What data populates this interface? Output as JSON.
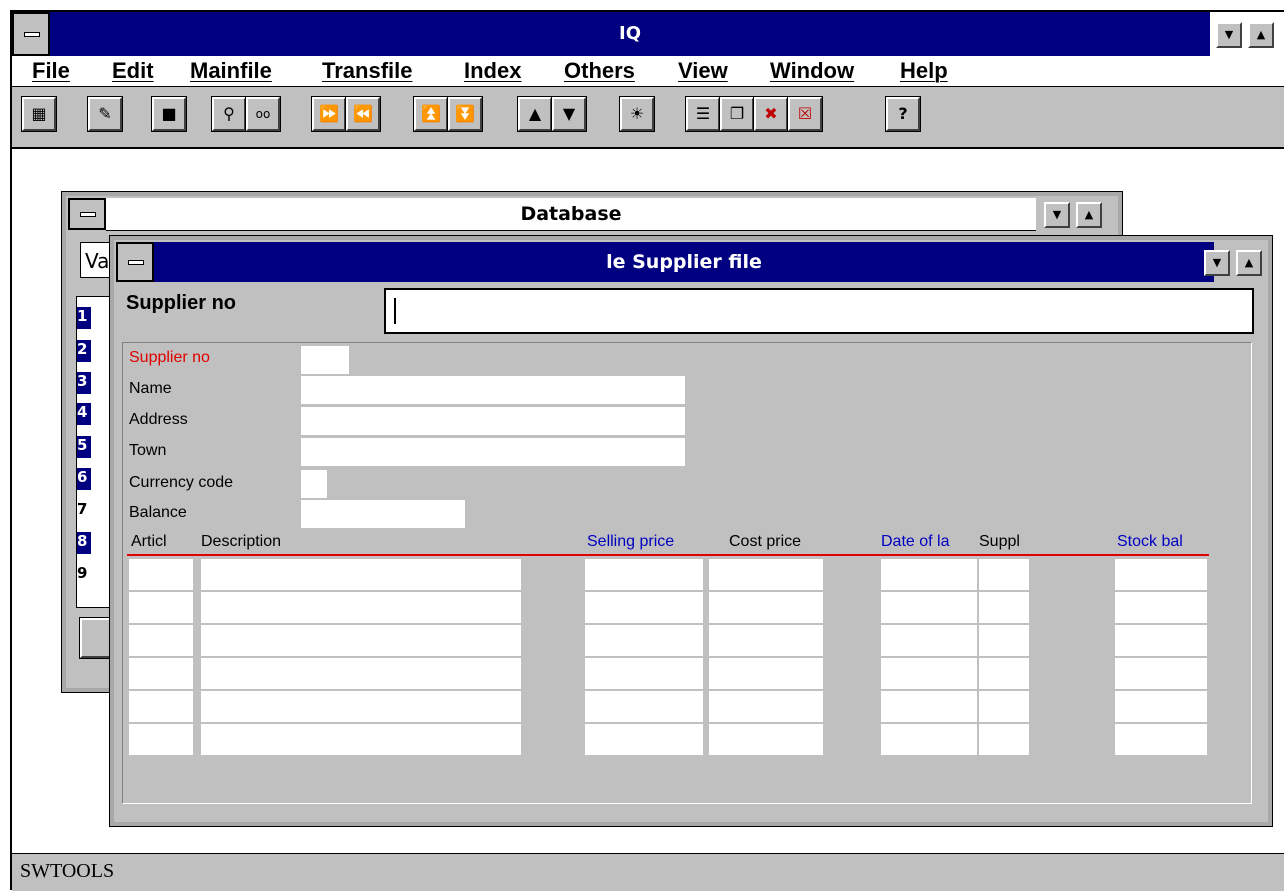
{
  "app": {
    "title": "IQ",
    "menu": [
      "File",
      "Edit",
      "Mainfile",
      "Transfile",
      "Index",
      "Others",
      "View",
      "Window",
      "Help"
    ],
    "toolbar_icons": [
      "calculator-icon",
      "edit-icon",
      "save-icon",
      "search-icon",
      "glasses-icon",
      "fast-forward-icon",
      "rewind-icon",
      "page-up-icon",
      "page-down-icon",
      "up-arrow-icon",
      "down-arrow-icon",
      "bulb-icon",
      "tile-icon",
      "cascade-icon",
      "close-all-icon",
      "close-icon",
      "help-icon"
    ],
    "status": "SWTOOLS"
  },
  "database_window": {
    "title": "Database",
    "combo_text": "Va",
    "list_items": [
      "1",
      "2",
      "3",
      "4",
      "5",
      "6",
      "7",
      "8",
      "9"
    ]
  },
  "supplier_window": {
    "title": "le Supplier file",
    "search_label": "Supplier no",
    "search_value": "",
    "fields": [
      {
        "label": "Supplier no",
        "value": ""
      },
      {
        "label": "Name",
        "value": ""
      },
      {
        "label": "Address",
        "value": ""
      },
      {
        "label": "Town",
        "value": ""
      },
      {
        "label": "Currency code",
        "value": ""
      },
      {
        "label": "Balance",
        "value": ""
      }
    ],
    "columns": [
      "Articl",
      "Description",
      "Selling price",
      "Cost price",
      "Date of la",
      "Suppl",
      "Stock bal"
    ],
    "colors": {
      "key_field": "#e00000",
      "highlight_col": "#0000c0",
      "rule": "#e00000"
    }
  }
}
